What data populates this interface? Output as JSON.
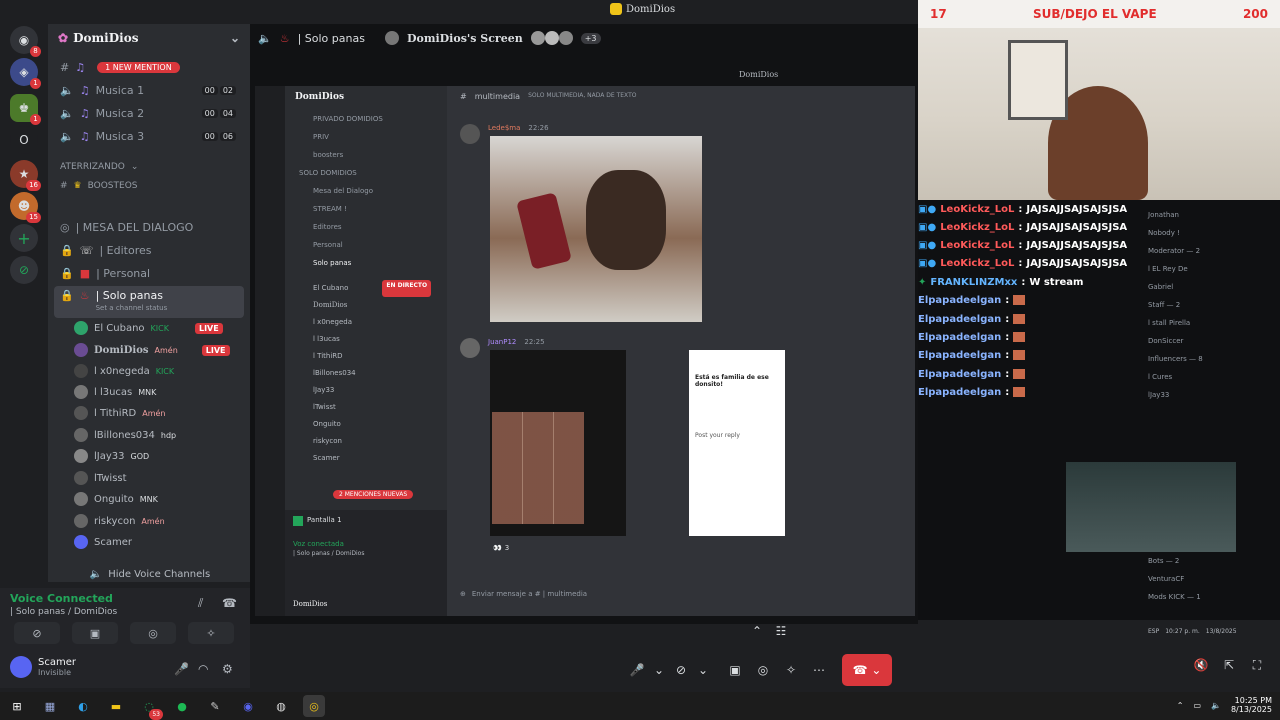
{
  "window": {
    "title": "DomiDios"
  },
  "rail": {
    "badges": [
      "8",
      "1",
      "1",
      "16",
      "15"
    ]
  },
  "server": {
    "name": "DomiDios",
    "new_mention": "1 NEW MENTION"
  },
  "channels": [
    {
      "name": "Musica 1",
      "count": "00",
      "cap": "02"
    },
    {
      "name": "Musica 2",
      "count": "00",
      "cap": "04"
    },
    {
      "name": "Musica 3",
      "count": "00",
      "cap": "06"
    }
  ],
  "category": "ATERRIZANDO",
  "boosteos": "BOOSTEOS",
  "text_channels": [
    {
      "name": "| MESA DEL DIALOGO"
    },
    {
      "name": "| Editores"
    },
    {
      "name": "| Personal"
    },
    {
      "name": "| Solo panas",
      "status": "Set a channel status"
    }
  ],
  "members": [
    {
      "name": "El Cubano",
      "tag": "KICK",
      "live": "LIVE",
      "color": "#2ea36b"
    },
    {
      "name": "DomiDios",
      "tag": "Amén",
      "live": "LIVE",
      "color": "#6a4c93"
    },
    {
      "name": "l x0negeda",
      "tag": "KICK",
      "live": "",
      "color": "#444"
    },
    {
      "name": "l l3ucas",
      "tag": "MNK",
      "live": "",
      "color": "#777"
    },
    {
      "name": "l TithiRD",
      "tag": "Amén",
      "live": "",
      "color": "#555"
    },
    {
      "name": "lBillones034",
      "tag": "hdp",
      "live": "",
      "color": "#666"
    },
    {
      "name": "lJay33",
      "tag": "GOD",
      "live": "",
      "color": "#888"
    },
    {
      "name": "lTwisst",
      "tag": "",
      "live": "",
      "color": "#555"
    },
    {
      "name": "Onguito",
      "tag": "MNK",
      "live": "",
      "color": "#777"
    },
    {
      "name": "riskycon",
      "tag": "Amén",
      "live": "",
      "color": "#666"
    },
    {
      "name": "Scamer",
      "tag": "",
      "live": "",
      "color": "#5865f2"
    }
  ],
  "hide_voice": "Hide Voice Channels",
  "voice": {
    "title": "Voice Connected",
    "sub": "| Solo panas / DomiDios"
  },
  "user": {
    "name": "Scamer",
    "status": "Invisible"
  },
  "stage": {
    "tab_label": "| Solo panas",
    "screen_label": "DomiDios's Screen",
    "extra": "+3",
    "inner_title": "DomiDios",
    "inner_channel": "multimedia",
    "inner_topic": "SOLO MULTIMEDIA, NADA DE TEXTO",
    "msg1_user": "Lede$ma",
    "msg1_time": "22:26",
    "msg2_user": "JuanP12",
    "msg2_time": "22:25",
    "post_text": "Está es familia de ese donsito!",
    "reply_placeholder": "Post your reply",
    "reaction_count": "3",
    "compose_placeholder": "Enviar mensaje a # | multimedia",
    "inner_server": "DomiDios",
    "inner_channels": [
      "PRIVADO DOMIDIOS",
      "PRIV",
      "boosters",
      "SOLO DOMIDIOS",
      "Mesa del Dialogo",
      "STREAM !",
      "Editores",
      "Personal",
      "Solo panas"
    ],
    "inner_members": [
      "El Cubano",
      "DomiDios",
      "l x0negeda",
      "l l3ucas",
      "l TithiRD",
      "lBillones034",
      "lJay33",
      "lTwisst",
      "Onguito",
      "riskycon",
      "Scamer"
    ],
    "mentions": "2 MENCIONES NUEVAS",
    "inner_voice": "Voz conectada",
    "inner_voice_sub": "| Solo panas / DomiDios",
    "inner_screen": "Pantalla 1",
    "inner_user": "DomiDios",
    "inner_live": "EN DIRECTO",
    "inner_category": "SOLO DOMIDIOS"
  },
  "cam": {
    "left": "17",
    "banner": "SUB/DEJO EL VAPE",
    "right": "200"
  },
  "chat": [
    {
      "user": "LeoKickz_LoL",
      "text": "JAJSAJJSAJSAJSJSA",
      "color": "#ff5a5a"
    },
    {
      "user": "LeoKickz_LoL",
      "text": "JAJSAJJSAJSAJSJSA",
      "color": "#ff5a5a"
    },
    {
      "user": "LeoKickz_LoL",
      "text": "JAJSAJJSAJSAJSJSA",
      "color": "#ff5a5a"
    },
    {
      "user": "LeoKickz_LoL",
      "text": "JAJSAJJSAJSAJSJSA",
      "color": "#ff5a5a"
    },
    {
      "user": "FRANKLINZMxx",
      "text": "W stream",
      "color": "#64b5ff"
    },
    {
      "user": "Elpapadeelgan",
      "text": "",
      "color": "#8ab4ff"
    },
    {
      "user": "Elpapadeelgan",
      "text": "",
      "color": "#8ab4ff"
    },
    {
      "user": "Elpapadeelgan",
      "text": "",
      "color": "#8ab4ff"
    },
    {
      "user": "Elpapadeelgan",
      "text": "",
      "color": "#8ab4ff"
    },
    {
      "user": "Elpapadeelgan",
      "text": "",
      "color": "#8ab4ff"
    },
    {
      "user": "Elpapadeelgan",
      "text": "",
      "color": "#8ab4ff"
    }
  ],
  "side_members": [
    "Jonathan",
    "Nobody !",
    "Moderator — 2",
    "l EL Rey De",
    "Gabriel",
    "Staff — 2",
    "l stall Pirella",
    "DonSiccer",
    "Influencers — 8",
    "l Cures",
    "lJay33",
    "Bots — 2",
    "VenturaCF",
    "Mods KICK — 1"
  ],
  "taskbar": {
    "time": "10:25 PM",
    "date": "8/13/2025",
    "badge": "53",
    "lang": "ESP",
    "small_time": "10:27 p. m.",
    "small_date": "13/8/2025"
  },
  "colors": {
    "accent": "#5865f2",
    "danger": "#da373c",
    "online": "#23a55a"
  }
}
